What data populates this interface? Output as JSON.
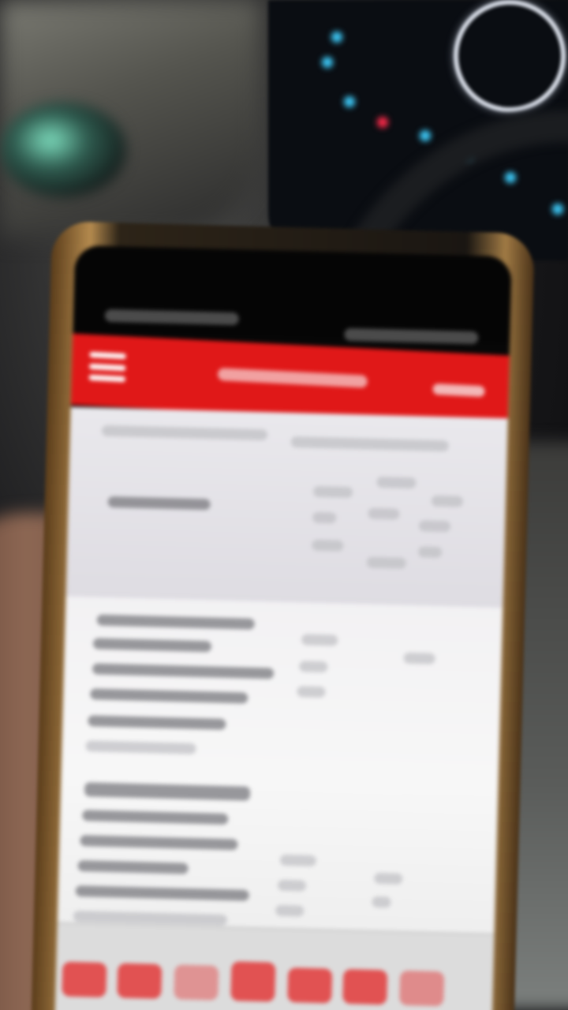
{
  "scene": {
    "description_colors": {
      "app_bar": "#e01818",
      "content_background": "#f2f2f2",
      "nav_items": "#e23a3a",
      "dashboard_led_cyan": "#3fd0ff",
      "dashboard_led_red": "#ff2a4a"
    }
  },
  "phone": {
    "app_bar": {
      "menu_icon": "hamburger-menu-icon",
      "title": "",
      "action_label": ""
    },
    "bottom_nav": {
      "items": [
        "nav-item-1",
        "nav-item-2",
        "nav-item-3",
        "nav-item-4",
        "nav-item-5",
        "nav-item-6",
        "nav-item-7"
      ]
    }
  }
}
